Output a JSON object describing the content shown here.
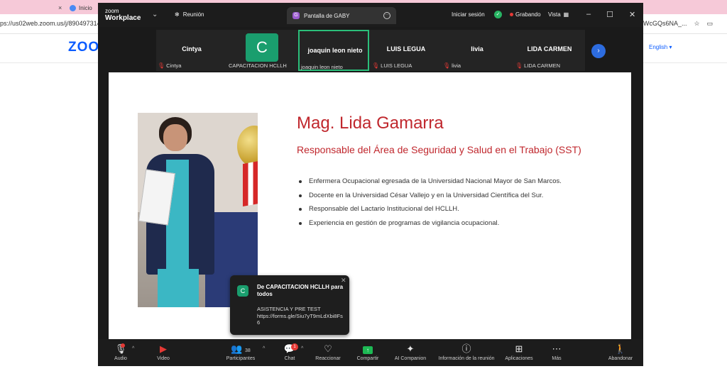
{
  "browser": {
    "tab1_label": "×",
    "tab2_label": "Inicio",
    "address": "ps://us02web.zoom.us/j/8904973140",
    "address_right": "WcGQs6NA_...",
    "page_logo": "ZOO",
    "language": "English ▾"
  },
  "zoom": {
    "logo_line1": "zoom",
    "logo_line2": "Workplace",
    "meeting_label": "Reunión",
    "share_tab": "Pantalla de GABY",
    "login": "Iniciar sesión",
    "recording": "Grabando",
    "view": "Vista",
    "participants": [
      {
        "name": "Cintya",
        "label": "Cintya",
        "muted": true
      },
      {
        "name": "",
        "label": "CAPACITACION HCLLH",
        "avatar": "C",
        "muted": false
      },
      {
        "name": "joaquin leon nieto",
        "label": "joaquin leon nieto",
        "muted": false,
        "active": true
      },
      {
        "name": "LUIS LEGUA",
        "label": "LUIS LEGUA",
        "muted": true
      },
      {
        "name": "livia",
        "label": "livia",
        "muted": true
      },
      {
        "name": "LIDA CARMEN",
        "label": "LIDA CARMEN",
        "muted": true
      }
    ]
  },
  "slide": {
    "title": "Mag. Lida Gamarra",
    "subtitle": "Responsable del Área de Seguridad y Salud en el Trabajo (SST)",
    "bullets": [
      "Enfermera Ocupacional egresada de la Universidad Nacional Mayor de San Marcos.",
      "Docente en la Universidad César Vallejo y en la Universidad Científica del Sur.",
      "Responsable del Lactario Institucional del HCLLH.",
      "Experiencia en gestión de programas de vigilancia ocupacional."
    ]
  },
  "chat_popup": {
    "avatar": "C",
    "from": "De CAPACITACION HCLLH para todos",
    "message_line1": "ASISTENCIA Y PRE TEST",
    "message_line2": "https://forms.gle/Siu7yT9mLdXbi8Fs6"
  },
  "toolbar": {
    "audio": "Audio",
    "video": "Video",
    "participants": "Participantes",
    "participants_count": "38",
    "chat": "Chat",
    "chat_badge": "1",
    "react": "Reaccionar",
    "share": "Compartir",
    "ai": "AI Companion",
    "info": "Información de la reunión",
    "apps": "Aplicaciones",
    "more": "Más",
    "leave": "Abandonar"
  }
}
